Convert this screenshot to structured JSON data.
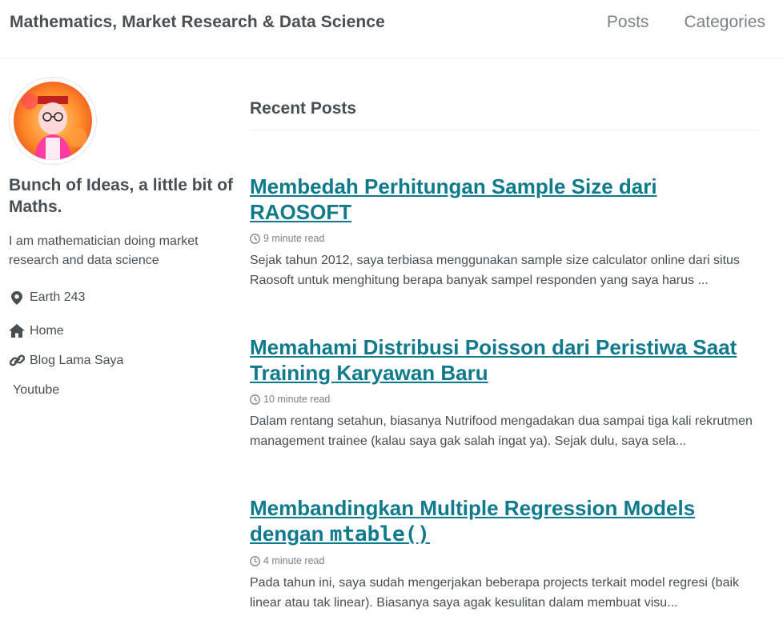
{
  "masthead": {
    "site_title": "Mathematics, Market Research & Data Science",
    "nav": [
      {
        "label": "Posts"
      },
      {
        "label": "Categories"
      }
    ]
  },
  "author": {
    "avatar_icon": "author-avatar-photo",
    "name": "Bunch of Ideas, a little bit of Maths.",
    "bio": "I am mathematician doing market research and data science",
    "links": [
      {
        "icon": "map-marker-icon",
        "label": "Earth 243"
      },
      {
        "icon": "home-icon",
        "label": "Home"
      },
      {
        "icon": "link-icon",
        "label": "Blog Lama Saya"
      },
      {
        "icon": "",
        "label": "Youtube"
      }
    ]
  },
  "main": {
    "archive_title": "Recent Posts",
    "posts": [
      {
        "title": "Membedah Perhitungan Sample Size dari RAOSOFT",
        "read_time": "9 minute read",
        "excerpt": "Sejak tahun 2012, saya terbiasa menggunakan sample size calculator online dari situs Raosoft untuk menghitung berapa banyak sampel responden yang saya harus ..."
      },
      {
        "title": "Memahami Distribusi Poisson dari Peristiwa Saat Training Karyawan Baru",
        "read_time": "10 minute read",
        "excerpt": "Dalam rentang setahun, biasanya Nutrifood mengadakan dua sampai tiga kali rekrutmen management trainee (kalau saya gak salah ingat ya). Sejak dulu, saya sela..."
      },
      {
        "title_prefix": "Membandingkan Multiple Regression Models dengan",
        "title_code": "mtable()",
        "read_time": "4 minute read",
        "excerpt": "Pada tahun ini, saya sudah mengerjakan beberapa projects terkait model regresi (baik linear atau tak linear). Biasanya saya agak kesulitan dalam membuat visu..."
      }
    ]
  },
  "colors": {
    "link": "#0f7a8c",
    "text": "#494e52",
    "muted": "#7a8288"
  }
}
